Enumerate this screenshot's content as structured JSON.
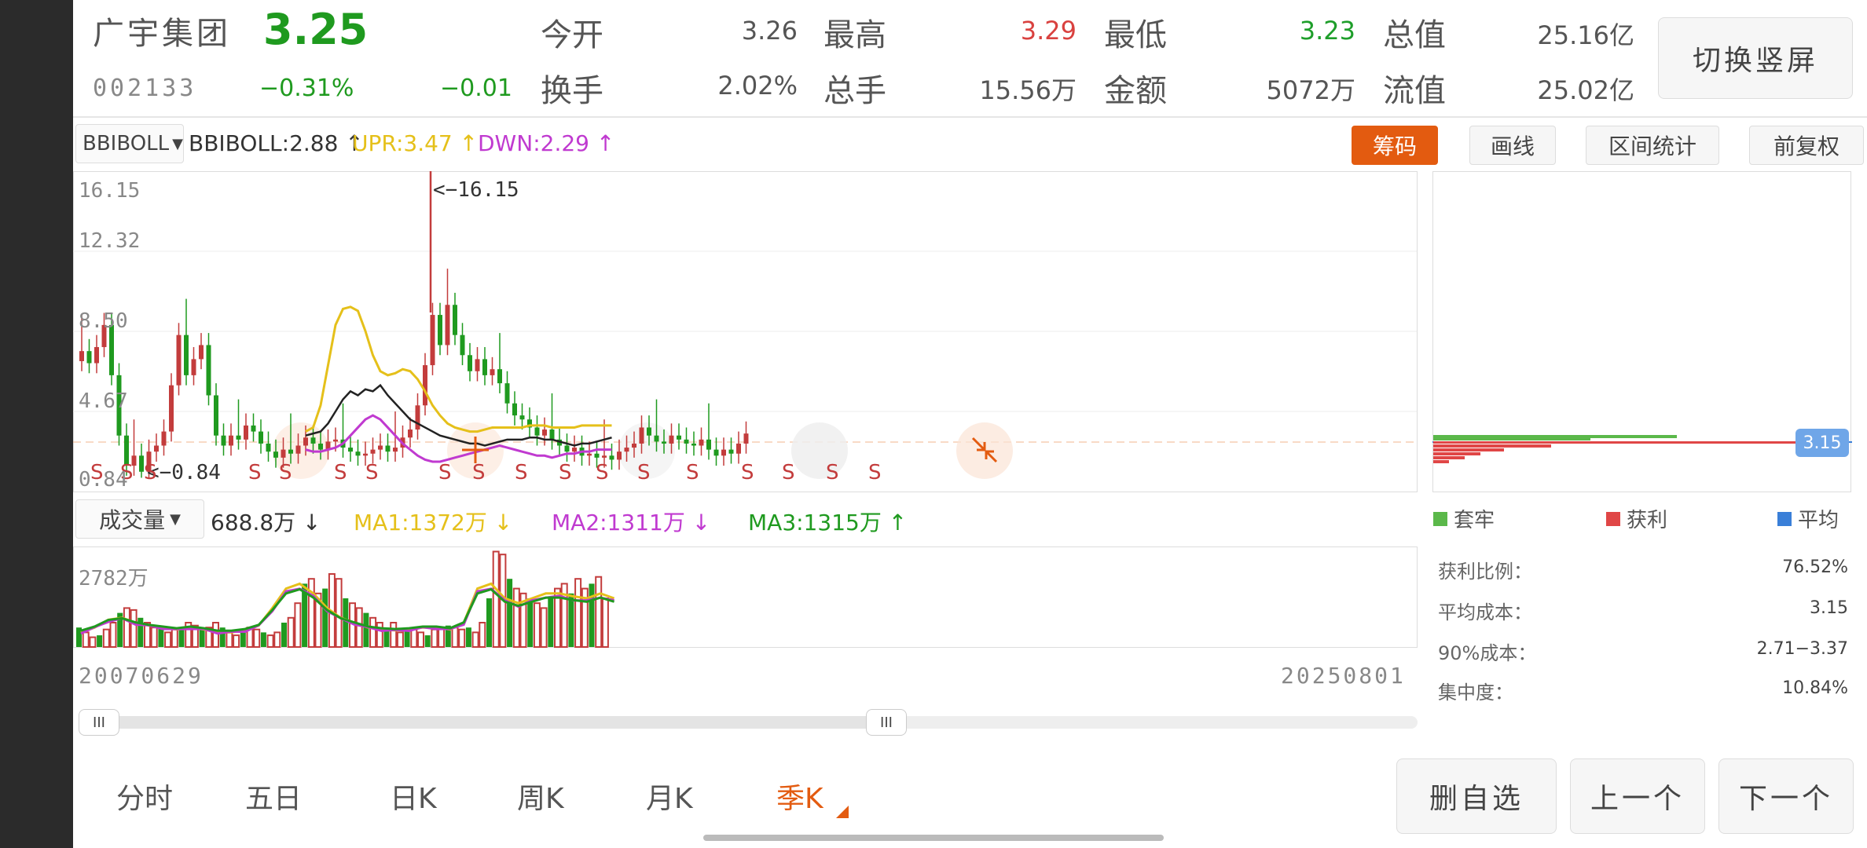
{
  "header": {
    "stock_name": "广宇集团",
    "price": "3.25",
    "code": "002133",
    "change_pct": "−0.31%",
    "change_amt": "−0.01",
    "fields": [
      {
        "label": "今开",
        "value": "3.26",
        "color": "#555555"
      },
      {
        "label": "最高",
        "value": "3.29",
        "color": "#d9413f"
      },
      {
        "label": "最低",
        "value": "3.23",
        "color": "#1e9e2a"
      },
      {
        "label": "总值",
        "value": "25.16亿",
        "color": "#555555"
      },
      {
        "label": "换手",
        "value": "2.02%",
        "color": "#555555"
      },
      {
        "label": "总手",
        "value": "15.56万",
        "color": "#555555"
      },
      {
        "label": "金额",
        "value": "5072万",
        "color": "#555555"
      },
      {
        "label": "流值",
        "value": "25.02亿",
        "color": "#555555"
      }
    ],
    "switch_button": "切换竖屏"
  },
  "toolbar": {
    "indicator_select": "BBIBOLL",
    "bbiboll": "BBIBOLL:2.88 ↑",
    "upr": "UPR:3.47 ↑",
    "dwn": "DWN:2.29 ↑",
    "buttons": {
      "chips": "筹码",
      "draw": "画线",
      "range_stats": "区间统计",
      "adjust": "前复权"
    }
  },
  "main_chart": {
    "y_labels": [
      "16.15",
      "12.32",
      "8.50",
      "4.67",
      "0.84"
    ],
    "max_annotation": "<−16.15",
    "min_annotation": "<−0.84",
    "signal_letter": "S",
    "signals_s_count": 15,
    "current_price": 3.15
  },
  "volume": {
    "select": "成交量",
    "value": "688.8万 ↓",
    "ma1": "MA1:1372万 ↓",
    "ma2": "MA2:1311万 ↓",
    "ma3": "MA3:1315万 ↑",
    "y_label": "2782万"
  },
  "dates": {
    "start": "20070629",
    "end": "20250801"
  },
  "chips": {
    "legend": [
      {
        "label": "套牢",
        "color": "#5bb84a"
      },
      {
        "label": "获利",
        "color": "#e04646"
      },
      {
        "label": "平均",
        "color": "#3a7fd8"
      }
    ],
    "price_tag": "3.15",
    "stats": [
      {
        "label": "获利比例：",
        "value": "76.52%"
      },
      {
        "label": "平均成本：",
        "value": "3.15"
      },
      {
        "label": "90%成本：",
        "value": "2.71−3.37"
      },
      {
        "label": "集中度：",
        "value": "10.84%"
      }
    ]
  },
  "bottom_tabs": [
    {
      "label": "分时",
      "active": false
    },
    {
      "label": "五日",
      "active": false
    },
    {
      "label": "日K",
      "active": false
    },
    {
      "label": "周K",
      "active": false
    },
    {
      "label": "月K",
      "active": false
    },
    {
      "label": "季K",
      "active": true
    }
  ],
  "actions": {
    "delete_fav": "删自选",
    "prev": "上一个",
    "next": "下一个"
  },
  "colors": {
    "up": "#c33c3c",
    "down": "#1f9a1f",
    "accent": "#e35b10",
    "boll_mid": "#222222",
    "boll_upr": "#e5c01a",
    "boll_dwn": "#c03ad0"
  }
}
